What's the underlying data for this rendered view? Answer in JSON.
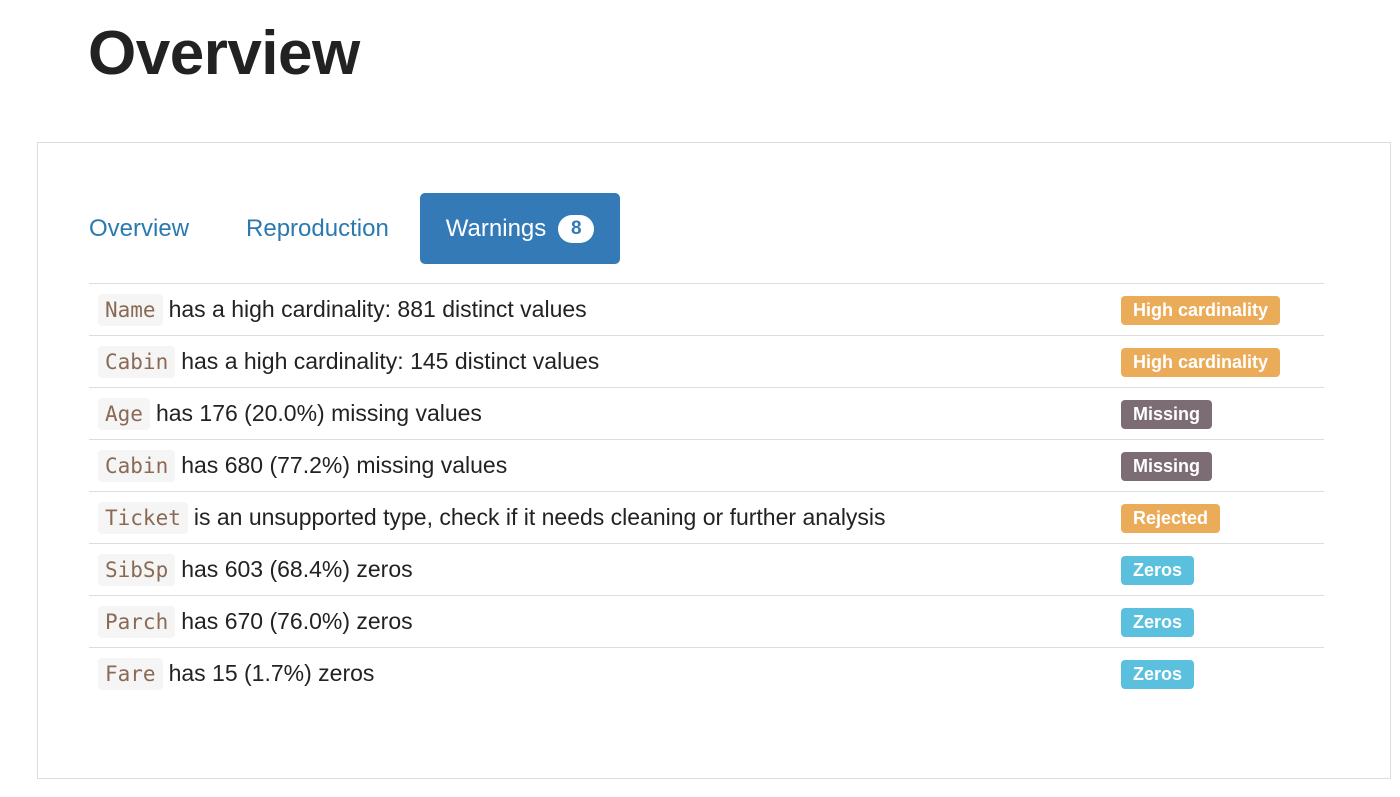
{
  "page_title": "Overview",
  "tabs": [
    {
      "label": "Overview",
      "active": false
    },
    {
      "label": "Reproduction",
      "active": false
    },
    {
      "label": "Warnings",
      "active": true,
      "count": "8"
    }
  ],
  "colors": {
    "tab_active": "#337ab7",
    "high_cardinality": "#ebac59",
    "missing": "#7c6c73",
    "rejected": "#ebac59",
    "zeros": "#5bc0de"
  },
  "warnings": [
    {
      "column": "Name",
      "message": "has a high cardinality: 881 distinct values",
      "badge": "High cardinality",
      "color": "#ebac59"
    },
    {
      "column": "Cabin",
      "message": "has a high cardinality: 145 distinct values",
      "badge": "High cardinality",
      "color": "#ebac59"
    },
    {
      "column": "Age",
      "message": "has 176 (20.0%) missing values",
      "badge": "Missing",
      "color": "#7c6c73"
    },
    {
      "column": "Cabin",
      "message": "has 680 (77.2%) missing values",
      "badge": "Missing",
      "color": "#7c6c73"
    },
    {
      "column": "Ticket",
      "message": "is an unsupported type, check if it needs cleaning or further analysis",
      "badge": "Rejected",
      "color": "#ebac59"
    },
    {
      "column": "SibSp",
      "message": "has 603 (68.4%) zeros",
      "badge": "Zeros",
      "color": "#5bc0de"
    },
    {
      "column": "Parch",
      "message": "has 670 (76.0%) zeros",
      "badge": "Zeros",
      "color": "#5bc0de"
    },
    {
      "column": "Fare",
      "message": "has 15 (1.7%) zeros",
      "badge": "Zeros",
      "color": "#5bc0de"
    }
  ]
}
